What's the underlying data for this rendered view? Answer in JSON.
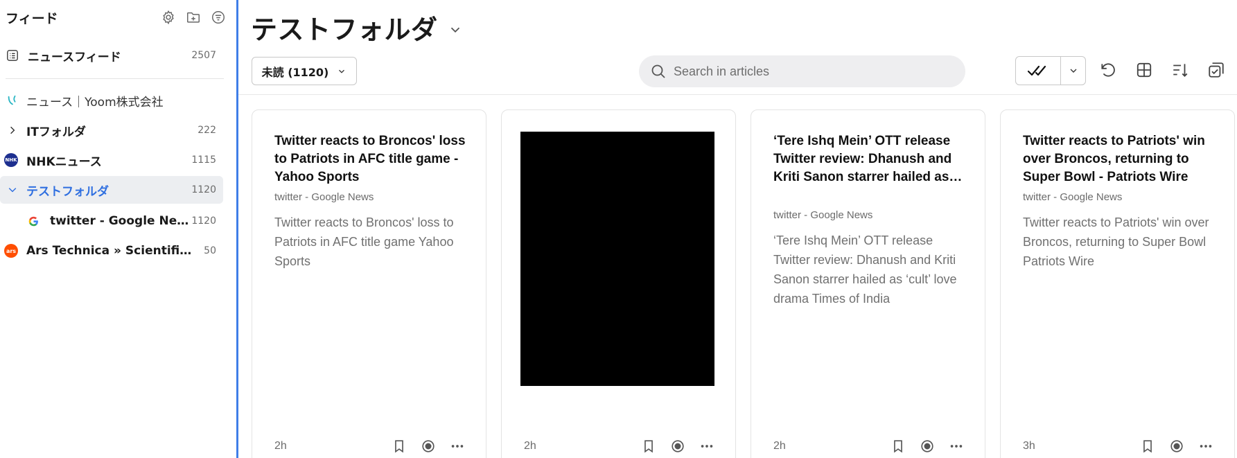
{
  "sidebar": {
    "title": "フィード",
    "header_icons": [
      "gear-icon",
      "add-folder-icon",
      "filter-icon"
    ],
    "all_feed": {
      "label": "ニュースフィード",
      "count": "2507"
    },
    "items": [
      {
        "label": "ニュース｜Yoom株式会社",
        "count": ""
      },
      {
        "label": "ITフォルダ",
        "count": "222"
      },
      {
        "label": "NHKニュース",
        "count": "1115"
      },
      {
        "label": "テストフォルダ",
        "count": "1120"
      },
      {
        "label": "twitter - Google News",
        "count": "1120"
      },
      {
        "label": "Ars Technica » Scientific Method",
        "count": "50"
      }
    ],
    "accent_color": "#2f6fe0"
  },
  "main": {
    "title": "テストフォルダ",
    "filter_label": "未読 (1120)",
    "search_placeholder": "Search in articles",
    "toolbar_icons": [
      "mark-all-read-icon",
      "refresh-icon",
      "grid-layout-icon",
      "sort-icon",
      "select-multiple-icon"
    ]
  },
  "cards": [
    {
      "title": "Twitter reacts to Broncos' loss to Patriots in AFC title game - Yahoo Sports",
      "source": "twitter - Google News",
      "summary": "Twitter reacts to Broncos' loss to Patriots in AFC title game  Yahoo Sports",
      "time": "2h"
    },
    {
      "title": "",
      "source": "",
      "summary": "",
      "time": "2h",
      "has_image": true
    },
    {
      "title": "‘Tere Ishq Mein’ OTT release Twitter review: Dhanush and Kriti Sanon starrer hailed as ‘cult’ love drama - Times of India",
      "source": "twitter - Google News",
      "summary": "‘Tere Ishq Mein’ OTT release Twitter review: Dhanush and Kriti Sanon starrer hailed as ‘cult’ love drama  Times of India",
      "time": "2h"
    },
    {
      "title": "Twitter reacts to Patriots' win over Broncos, returning to Super Bowl - Patriots Wire",
      "source": "twitter - Google News",
      "summary": "Twitter reacts to Patriots' win over Broncos, returning to Super Bowl  Patriots Wire",
      "time": "3h"
    }
  ]
}
